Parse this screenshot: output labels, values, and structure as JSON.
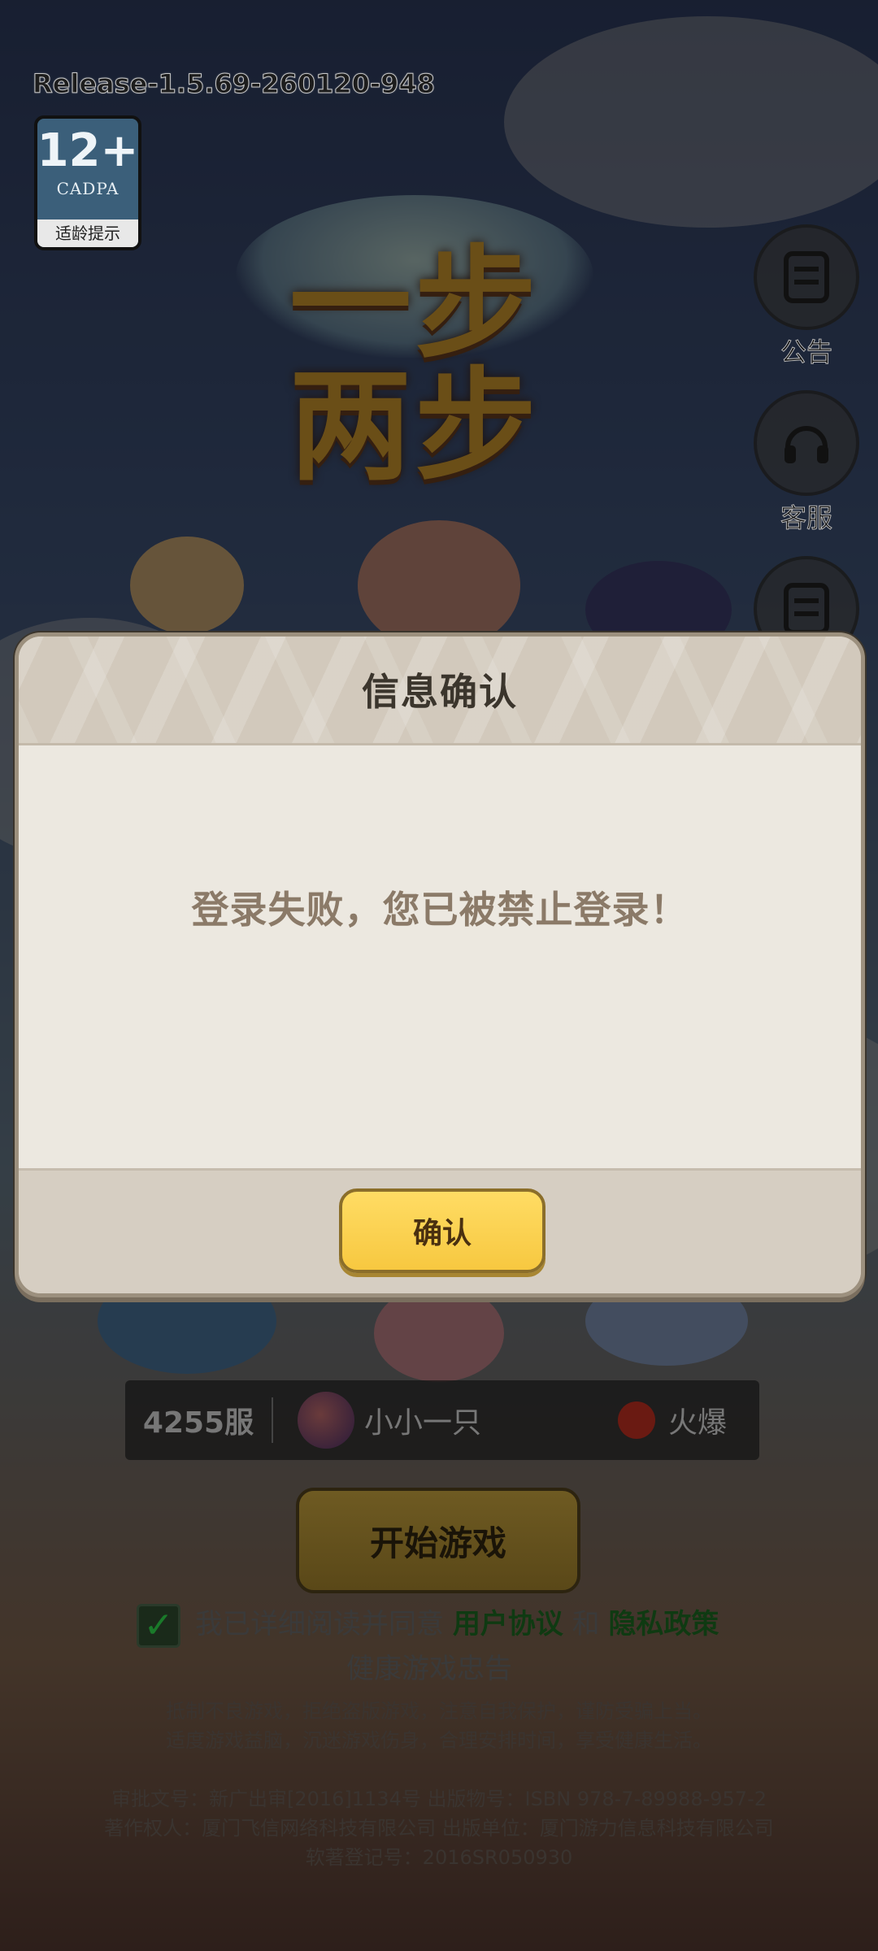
{
  "build": {
    "release_label": "Release-1.5.69-260120-948"
  },
  "age_rating": {
    "age": "12+",
    "org": "CADPA",
    "tip": "适龄提示"
  },
  "side_buttons": [
    {
      "label": "公告",
      "icon": "notice-icon"
    },
    {
      "label": "客服",
      "icon": "headset-icon"
    },
    {
      "label": "",
      "icon": "notice-icon"
    }
  ],
  "server": {
    "server_label": "4255服",
    "player_name": "小小一只",
    "status": "火爆"
  },
  "start_button": {
    "label": "开始游戏"
  },
  "agreement": {
    "prefix": "我已详细阅读并同意",
    "user_agreement": "用户协议",
    "and": "和",
    "privacy_policy": "隐私政策",
    "line2": "健康游戏忠告"
  },
  "health_notice": {
    "line1": "抵制不良游戏，拒绝盗版游戏，注意自我保护，谨防受骗上当。",
    "line2": "适度游戏益脑，沉迷游戏伤身，合理安排时间，享受健康生活。"
  },
  "publication": {
    "line1": "审批文号：新广出审[2016]1134号  出版物号：ISBN 978-7-89988-957-2",
    "line2": "著作权人：厦门飞信网络科技有限公司  出版单位：厦门游力信息科技有限公司",
    "line3": "软著登记号：2016SR050930"
  },
  "dialog": {
    "title": "信息确认",
    "message": "登录失败，您已被禁止登录！",
    "confirm_label": "确认"
  }
}
